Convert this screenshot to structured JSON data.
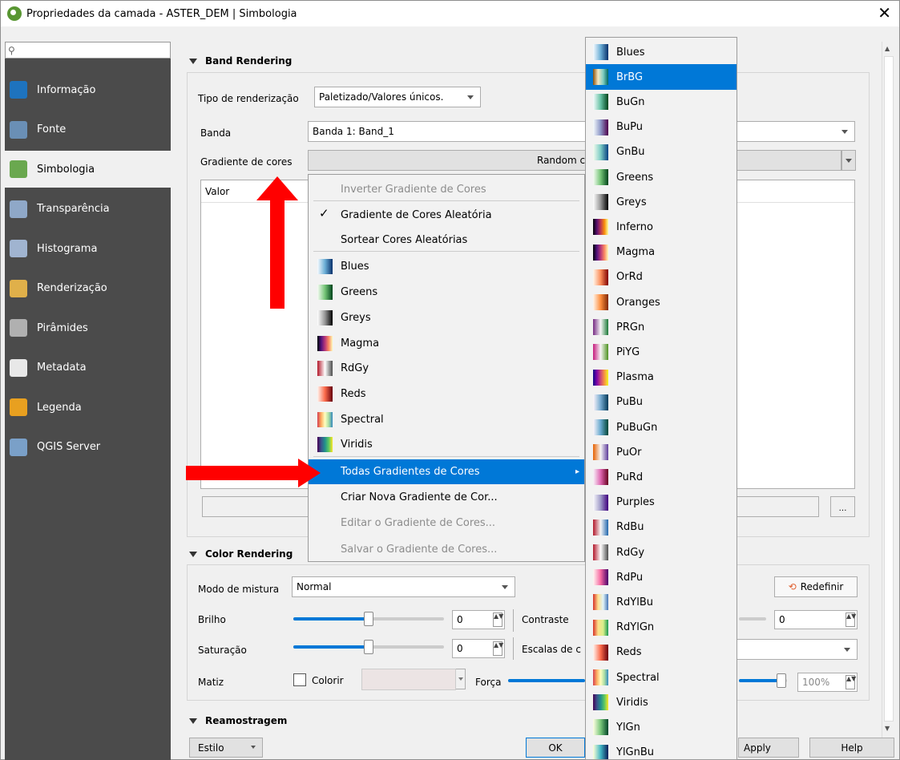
{
  "window": {
    "title": "Propriedades da camada - ASTER_DEM | Simbologia",
    "close": "✕"
  },
  "search": {
    "icon": "⚲"
  },
  "sidebar": {
    "items": [
      {
        "label": "Informação",
        "icon": "info-icon",
        "color": "#1e73be"
      },
      {
        "label": "Fonte",
        "icon": "source-icon",
        "color": "#6a8fb5"
      },
      {
        "label": "Simbologia",
        "icon": "paintbrush-icon",
        "color": "#6aa84f"
      },
      {
        "label": "Transparência",
        "icon": "transparency-icon",
        "color": "#8fa8c8"
      },
      {
        "label": "Histograma",
        "icon": "histogram-icon",
        "color": "#a0b4d0"
      },
      {
        "label": "Renderização",
        "icon": "brush-icon",
        "color": "#e0b04a"
      },
      {
        "label": "Pirâmides",
        "icon": "pyramid-icon",
        "color": "#b0b0b0"
      },
      {
        "label": "Metadata",
        "icon": "metadata-icon",
        "color": "#e8e8e8"
      },
      {
        "label": "Legenda",
        "icon": "legend-icon",
        "color": "#e8a020"
      },
      {
        "label": "QGIS Server",
        "icon": "server-icon",
        "color": "#7aa0c8"
      }
    ]
  },
  "band": {
    "title": "Band Rendering",
    "render_type_label": "Tipo de renderização",
    "render_type_value": "Paletizado/Valores únicos.",
    "band_label": "Banda",
    "band_value": "Banda 1: Band_1",
    "gradient_label": "Gradiente de cores",
    "gradient_value": "Random c",
    "table_header": "Valor"
  },
  "color": {
    "title": "Color Rendering",
    "blend_label": "Modo de mistura",
    "blend_value": "Normal",
    "reset": "Redefinir",
    "brightness_label": "Brilho",
    "brightness_value": "0",
    "contrast_label": "Contraste",
    "contrast_value": "0",
    "saturation_label": "Saturação",
    "saturation_value": "0",
    "grayscale_label": "Escalas de c",
    "hue_label": "Matiz",
    "colorize_label": "Colorir",
    "strength_label": "Força",
    "strength_value": "100%"
  },
  "resample": {
    "title": "Reamostragem"
  },
  "footer": {
    "style": "Estilo",
    "ok": "OK",
    "apply": "Apply",
    "help": "Help"
  },
  "menu": {
    "items": [
      {
        "label": "Inverter Gradiente de Cores",
        "disabled": true
      },
      {
        "label": "Gradiente de Cores Aleatória",
        "check": "✓"
      },
      {
        "label": "Sortear Cores Aleatórias"
      },
      {
        "label": "Blues",
        "grad": "linear-gradient(90deg,#f7fbff,#6baed6,#08306b)"
      },
      {
        "label": "Greens",
        "grad": "linear-gradient(90deg,#f7fcf5,#74c476,#00441b)"
      },
      {
        "label": "Greys",
        "grad": "linear-gradient(90deg,#ffffff,#969696,#000000)"
      },
      {
        "label": "Magma",
        "grad": "linear-gradient(90deg,#000004,#51127c,#b73779,#fc8961,#fcfdbf)"
      },
      {
        "label": "RdGy",
        "grad": "linear-gradient(90deg,#b2182b,#ffffff,#4d4d4d)"
      },
      {
        "label": "Reds",
        "grad": "linear-gradient(90deg,#fff5f0,#fb6a4a,#67000d)"
      },
      {
        "label": "Spectral",
        "grad": "linear-gradient(90deg,#d53e4f,#fdae61,#ffffbf,#abdda4,#3288bd)"
      },
      {
        "label": "Viridis",
        "grad": "linear-gradient(90deg,#440154,#3b528b,#21918c,#5ec962,#fde725)"
      },
      {
        "label": "Todas Gradientes de Cores",
        "submenu": "▸"
      },
      {
        "label": "Criar Nova Gradiente de Cor..."
      },
      {
        "label": "Editar o Gradiente de Cores...",
        "disabled": true
      },
      {
        "label": "Salvar o Gradiente de Cores...",
        "disabled": true
      }
    ]
  },
  "submenu": {
    "items": [
      {
        "label": "Blues",
        "grad": "linear-gradient(90deg,#f7fbff,#6baed6,#08306b)"
      },
      {
        "label": "BrBG",
        "grad": "linear-gradient(90deg,#8c510a,#f6e8c3,#80cdc1,#01665e)"
      },
      {
        "label": "BuGn",
        "grad": "linear-gradient(90deg,#f7fcfd,#66c2a4,#00441b)"
      },
      {
        "label": "BuPu",
        "grad": "linear-gradient(90deg,#f7fcfd,#8c96c6,#4d004b)"
      },
      {
        "label": "GnBu",
        "grad": "linear-gradient(90deg,#f7fcf0,#7bccc4,#084081)"
      },
      {
        "label": "Greens",
        "grad": "linear-gradient(90deg,#f7fcf5,#74c476,#00441b)"
      },
      {
        "label": "Greys",
        "grad": "linear-gradient(90deg,#ffffff,#969696,#000000)"
      },
      {
        "label": "Inferno",
        "grad": "linear-gradient(90deg,#000004,#57106e,#bc3754,#f98e09,#fcffa4)"
      },
      {
        "label": "Magma",
        "grad": "linear-gradient(90deg,#000004,#51127c,#b73779,#fc8961,#fcfdbf)"
      },
      {
        "label": "OrRd",
        "grad": "linear-gradient(90deg,#fff7ec,#fc8d59,#7f0000)"
      },
      {
        "label": "Oranges",
        "grad": "linear-gradient(90deg,#fff5eb,#fd8d3c,#7f2704)"
      },
      {
        "label": "PRGn",
        "grad": "linear-gradient(90deg,#762a83,#f7f7f7,#1b7837)"
      },
      {
        "label": "PiYG",
        "grad": "linear-gradient(90deg,#c51b7d,#f7f7f7,#4d9221)"
      },
      {
        "label": "Plasma",
        "grad": "linear-gradient(90deg,#0d0887,#7e03a8,#cc4778,#f89540,#f0f921)"
      },
      {
        "label": "PuBu",
        "grad": "linear-gradient(90deg,#fff7fb,#74a9cf,#023858)"
      },
      {
        "label": "PuBuGn",
        "grad": "linear-gradient(90deg,#fff7fb,#67a9cf,#014636)"
      },
      {
        "label": "PuOr",
        "grad": "linear-gradient(90deg,#e66101,#f7f7f7,#5e3c99)"
      },
      {
        "label": "PuRd",
        "grad": "linear-gradient(90deg,#f7f4f9,#df65b0,#67001f)"
      },
      {
        "label": "Purples",
        "grad": "linear-gradient(90deg,#fcfbfd,#9e9ac8,#3f007d)"
      },
      {
        "label": "RdBu",
        "grad": "linear-gradient(90deg,#b2182b,#f7f7f7,#2166ac)"
      },
      {
        "label": "RdGy",
        "grad": "linear-gradient(90deg,#b2182b,#ffffff,#4d4d4d)"
      },
      {
        "label": "RdPu",
        "grad": "linear-gradient(90deg,#fff7f3,#f768a1,#49006a)"
      },
      {
        "label": "RdYlBu",
        "grad": "linear-gradient(90deg,#d73027,#fee090,#e0f3f8,#4575b4)"
      },
      {
        "label": "RdYlGn",
        "grad": "linear-gradient(90deg,#d73027,#fee08b,#d9ef8b,#1a9850)"
      },
      {
        "label": "Reds",
        "grad": "linear-gradient(90deg,#fff5f0,#fb6a4a,#67000d)"
      },
      {
        "label": "Spectral",
        "grad": "linear-gradient(90deg,#d53e4f,#fdae61,#ffffbf,#abdda4,#3288bd)"
      },
      {
        "label": "Viridis",
        "grad": "linear-gradient(90deg,#440154,#3b528b,#21918c,#5ec962,#fde725)"
      },
      {
        "label": "YlGn",
        "grad": "linear-gradient(90deg,#ffffe5,#78c679,#004529)"
      },
      {
        "label": "YlGnBu",
        "grad": "linear-gradient(90deg,#ffffd9,#41b6c4,#081d58)"
      }
    ]
  },
  "colors": {
    "accent": "#0078d7",
    "annotation": "#ff0000"
  }
}
